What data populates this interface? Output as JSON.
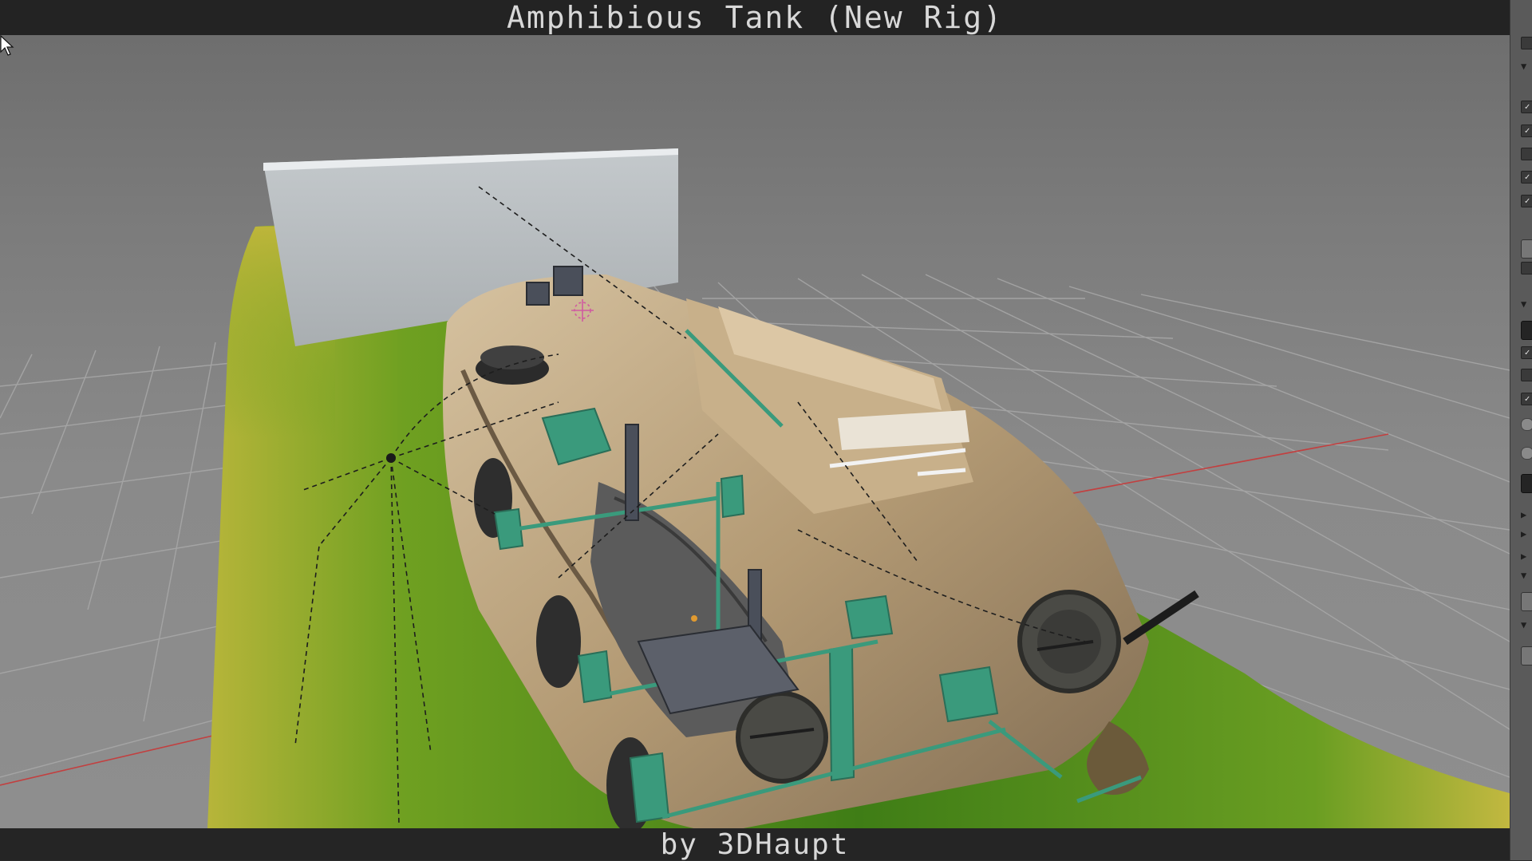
{
  "header": {
    "title": "Amphibious Tank (New Rig)"
  },
  "footer": {
    "credit": "by 3DHaupt"
  },
  "viewport": {
    "scene": "3d-tank-rig",
    "colors": {
      "ground_green": "#5f9a1e",
      "ground_yellow": "#c9c23a",
      "tank_body": "#b8a07a",
      "rig_control": "#3a9a7c",
      "grid_line": "#a8a8a8",
      "x_axis": "#c24040"
    }
  },
  "side_panel": {
    "items": [
      {
        "type": "check",
        "name": "toggle-1",
        "checked": false
      },
      {
        "type": "tri",
        "name": "expand-1",
        "icon": "triangle-down-icon"
      },
      {
        "type": "check",
        "name": "toggle-2",
        "checked": true
      },
      {
        "type": "check",
        "name": "toggle-3",
        "checked": true
      },
      {
        "type": "check",
        "name": "toggle-4",
        "checked": false
      },
      {
        "type": "check",
        "name": "toggle-5",
        "checked": true
      },
      {
        "type": "check",
        "name": "toggle-6",
        "checked": true
      },
      {
        "type": "box",
        "name": "field-1"
      },
      {
        "type": "check",
        "name": "toggle-7",
        "checked": false
      },
      {
        "type": "tri",
        "name": "expand-2",
        "icon": "triangle-down-icon"
      },
      {
        "type": "dark",
        "name": "field-2"
      },
      {
        "type": "check",
        "name": "toggle-8",
        "checked": true
      },
      {
        "type": "check",
        "name": "toggle-9",
        "checked": false
      },
      {
        "type": "check",
        "name": "toggle-10",
        "checked": true
      },
      {
        "type": "circle",
        "name": "radio-1"
      },
      {
        "type": "circle",
        "name": "radio-2"
      },
      {
        "type": "dark",
        "name": "field-3"
      },
      {
        "type": "tri",
        "name": "expand-3",
        "icon": "triangle-right-icon"
      },
      {
        "type": "tri",
        "name": "expand-4",
        "icon": "triangle-right-icon"
      },
      {
        "type": "tri",
        "name": "expand-5",
        "icon": "triangle-right-icon"
      },
      {
        "type": "tri",
        "name": "expand-6",
        "icon": "triangle-down-icon"
      },
      {
        "type": "box",
        "name": "field-4"
      },
      {
        "type": "tri",
        "name": "expand-7",
        "icon": "triangle-down-icon"
      },
      {
        "type": "box",
        "name": "field-5"
      }
    ]
  }
}
